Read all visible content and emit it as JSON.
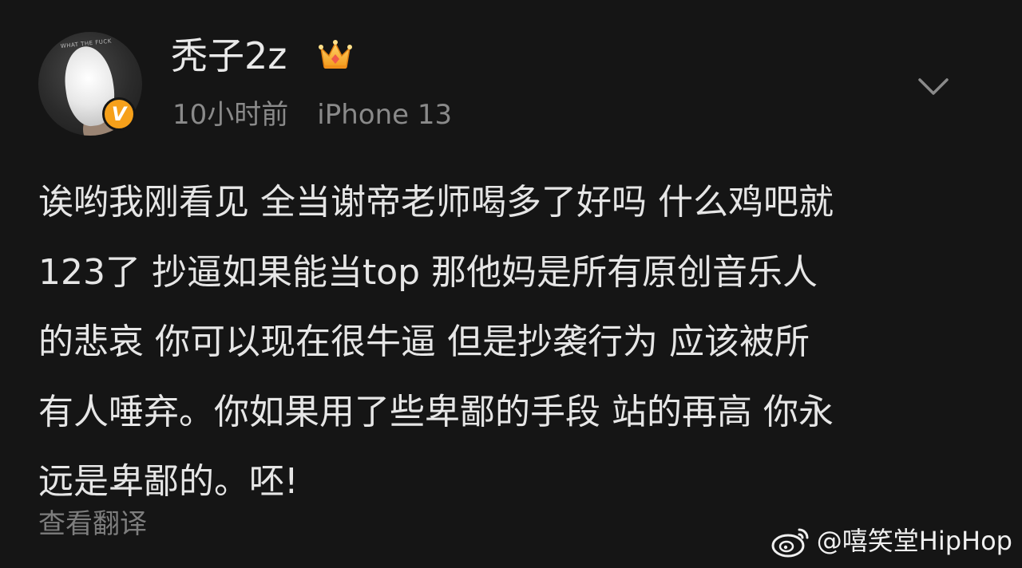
{
  "post": {
    "username": "秃子2z",
    "timestamp": "10小时前",
    "device": "iPhone 13",
    "lines": [
      "诶哟我刚看见 全当谢帝老师喝多了好吗 什么鸡吧就",
      "123了 抄逼如果能当top 那他妈是所有原创音乐人",
      "的悲哀 你可以现在很牛逼 但是抄袭行为 应该被所",
      "有人唾弃。你如果用了些卑鄙的手段 站的再高 你永",
      "远是卑鄙的。呸!"
    ],
    "translate_label": "查看翻译",
    "verified_mark": "V",
    "avatar_caption": "WHAT THE FUCK"
  },
  "watermark": {
    "text": "@嘻笑堂HipHop"
  },
  "icons": {
    "crown": "crown-icon",
    "chevron": "chevron-down-icon",
    "verified": "verified-badge-icon",
    "weibo": "weibo-logo-icon"
  },
  "colors": {
    "background": "#151515",
    "text": "#e6e6e6",
    "meta": "#8a8a8a",
    "verified": "#f6a01a"
  }
}
